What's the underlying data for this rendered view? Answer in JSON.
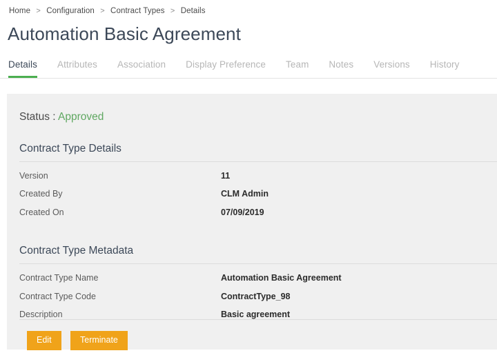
{
  "breadcrumb": {
    "separator": ">",
    "items": [
      {
        "label": "Home"
      },
      {
        "label": "Configuration"
      },
      {
        "label": "Contract Types"
      },
      {
        "label": "Details"
      }
    ]
  },
  "page_title": "Automation Basic Agreement",
  "tabs": [
    {
      "label": "Details",
      "active": true
    },
    {
      "label": "Attributes",
      "active": false
    },
    {
      "label": "Association",
      "active": false
    },
    {
      "label": "Display Preference",
      "active": false
    },
    {
      "label": "Team",
      "active": false
    },
    {
      "label": "Notes",
      "active": false
    },
    {
      "label": "Versions",
      "active": false
    },
    {
      "label": "History",
      "active": false
    }
  ],
  "status": {
    "label": "Status :",
    "value": "Approved"
  },
  "sections": [
    {
      "heading": "Contract Type Details",
      "fields": [
        {
          "label": "Version",
          "value": "11"
        },
        {
          "label": "Created By",
          "value": "CLM Admin"
        },
        {
          "label": "Created On",
          "value": "07/09/2019"
        }
      ]
    },
    {
      "heading": "Contract Type Metadata",
      "fields": [
        {
          "label": "Contract Type Name",
          "value": "Automation Basic Agreement"
        },
        {
          "label": "Contract Type Code",
          "value": "ContractType_98"
        },
        {
          "label": "Description",
          "value": "Basic agreement"
        }
      ]
    }
  ],
  "actions": [
    {
      "label": "Edit"
    },
    {
      "label": "Terminate"
    }
  ],
  "colors": {
    "accent_green": "#4caf50",
    "status_green": "#60a862",
    "button_orange": "#f0a31a",
    "panel_background": "#f0f0f0",
    "title_text": "#3c4858"
  }
}
